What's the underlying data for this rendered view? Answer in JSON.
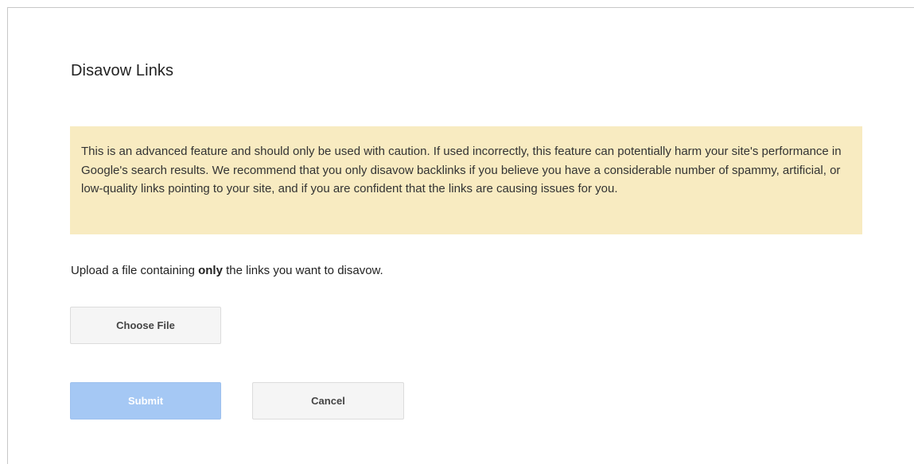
{
  "dialog": {
    "title": "Disavow Links",
    "warning_text": "This is an advanced feature and should only be used with caution. If used incorrectly, this feature can potentially harm your site's performance in Google's search results. We recommend that you only disavow backlinks if you believe you have a considerable number of spammy, artificial, or low-quality links pointing to your site, and if you are confident that the links are causing issues for you.",
    "instruction": {
      "before": "Upload a file containing ",
      "emphasis": "only",
      "after": " the links you want to disavow."
    },
    "choose_file_label": "Choose File",
    "submit_label": "Submit",
    "cancel_label": "Cancel"
  },
  "colors": {
    "warning_background": "#f8ebc1",
    "submit_disabled_background": "#a5c8f4",
    "button_background": "#f5f5f5"
  }
}
